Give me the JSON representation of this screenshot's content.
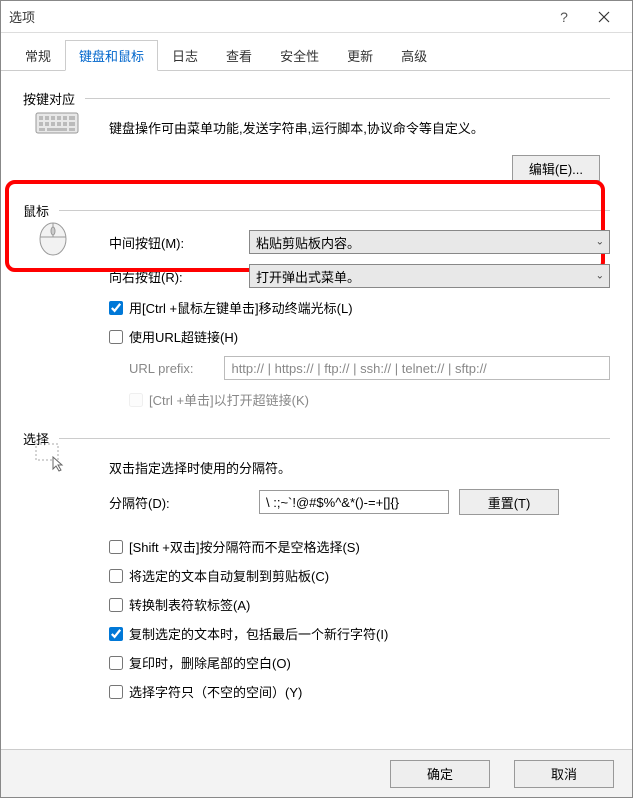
{
  "window": {
    "title": "选项"
  },
  "tabs": [
    "常规",
    "键盘和鼠标",
    "日志",
    "查看",
    "安全性",
    "更新",
    "高级"
  ],
  "active_tab_index": 1,
  "keypress": {
    "title": "按键对应",
    "desc": "键盘操作可由菜单功能,发送字符串,运行脚本,协议命令等自定义。",
    "edit_btn": "编辑(E)..."
  },
  "mouse": {
    "title": "鼠标",
    "middle_label": "中间按钮(M):",
    "middle_value": "粘贴剪贴板内容。",
    "right_label": "向右按钮(R):",
    "right_value": "打开弹出式菜单。",
    "ctrl_click": "用[Ctrl +鼠标左键单击]移动终端光标(L)",
    "url_hyperlink": "使用URL超链接(H)",
    "url_prefix_label": "URL prefix:",
    "url_prefix_value": "http:// | https:// | ftp:// | ssh:// | telnet:// | sftp://",
    "ctrl_click_link": "[Ctrl +单击]以打开超链接(K)"
  },
  "selection": {
    "title": "选择",
    "desc": "双击指定选择时使用的分隔符。",
    "delim_label": "分隔符(D):",
    "delim_value": "\\ :;~`!@#$%^&*()-=+[]{}",
    "reset_btn": "重置(T)",
    "shift_dbl": "[Shift +双击]按分隔符而不是空格选择(S)",
    "auto_copy": "将选定的文本自动复制到剪贴板(C)",
    "convert_tab": "转换制表符软标签(A)",
    "copy_newline": "复制选定的文本时，包括最后一个新行字符(I)",
    "trim_trail": "复印时，删除尾部的空白(O)",
    "select_chars": "选择字符只（不空的空间）(Y)"
  },
  "footer": {
    "ok": "确定",
    "cancel": "取消"
  }
}
